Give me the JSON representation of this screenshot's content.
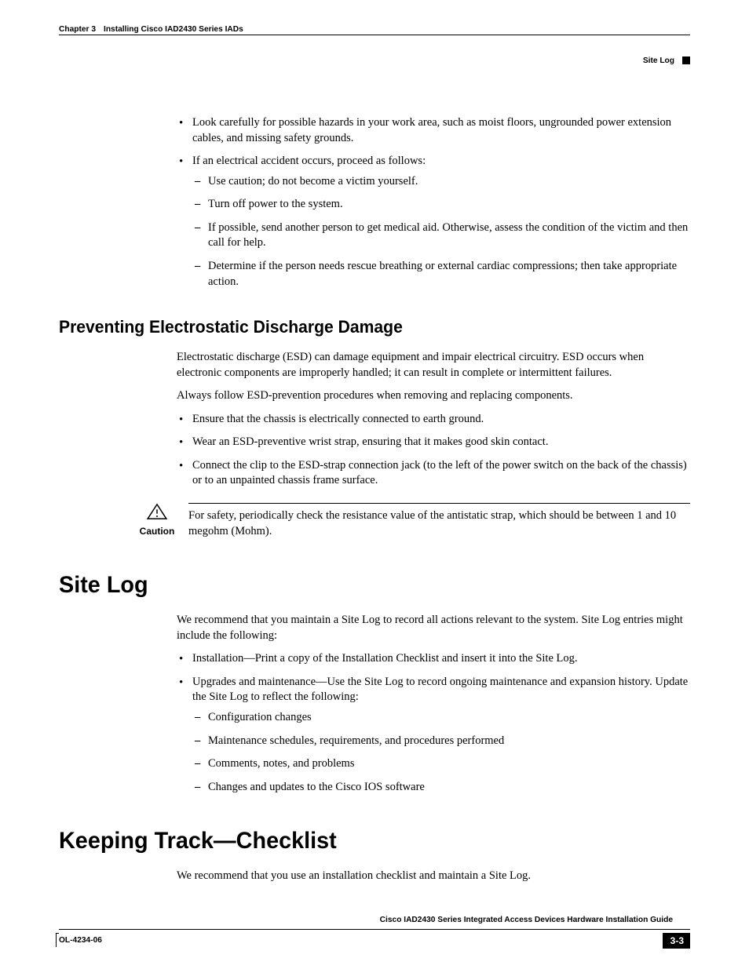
{
  "header": {
    "chapter": "Chapter 3",
    "chapterTitle": "Installing Cisco IAD2430 Series IADs",
    "sectionLabel": "Site Log"
  },
  "topBullets": {
    "b1": "Look carefully for possible hazards in your work area, such as moist floors, ungrounded power extension cables, and missing safety grounds.",
    "b2": "If an electrical accident occurs, proceed as follows:",
    "b2_d1": "Use caution; do not become a victim yourself.",
    "b2_d2": "Turn off power to the system.",
    "b2_d3": "If possible, send another person to get medical aid. Otherwise, assess the condition of the victim and then call for help.",
    "b2_d4": "Determine if the person needs rescue breathing or external cardiac compressions; then take appropriate action."
  },
  "esd": {
    "heading": "Preventing Electrostatic Discharge Damage",
    "p1": "Electrostatic discharge (ESD) can damage equipment and impair electrical circuitry. ESD occurs when electronic components are improperly handled; it can result in complete or intermittent failures.",
    "p2": "Always follow ESD-prevention procedures when removing and replacing components.",
    "b1": "Ensure that the chassis is electrically connected to earth ground.",
    "b2": "Wear an ESD-preventive wrist strap, ensuring that it makes good skin contact.",
    "b3": "Connect the clip to the ESD-strap connection jack (to the left of the power switch on the back of the chassis) or to an unpainted chassis frame surface."
  },
  "caution": {
    "label": "Caution",
    "text": "For safety, periodically check the resistance value of the antistatic strap, which should be between 1 and 10 megohm (Mohm)."
  },
  "siteLog": {
    "heading": "Site Log",
    "p1": "We recommend that you maintain a Site Log to record all actions relevant to the system. Site Log entries might include the following:",
    "b1": "Installation—Print a copy of the Installation Checklist and insert it into the Site Log.",
    "b2": "Upgrades and maintenance—Use the Site Log to record ongoing maintenance and expansion history. Update the Site Log to reflect the following:",
    "b2_d1": "Configuration changes",
    "b2_d2": "Maintenance schedules, requirements, and procedures performed",
    "b2_d3": "Comments, notes, and problems",
    "b2_d4": "Changes and updates to the Cisco IOS software"
  },
  "checklist": {
    "heading": "Keeping Track—Checklist",
    "p1": "We recommend that you use an installation checklist and maintain a Site Log."
  },
  "footer": {
    "docTitle": "Cisco IAD2430 Series Integrated Access Devices Hardware Installation Guide",
    "docNum": "OL-4234-06",
    "pageNum": "3-3"
  }
}
